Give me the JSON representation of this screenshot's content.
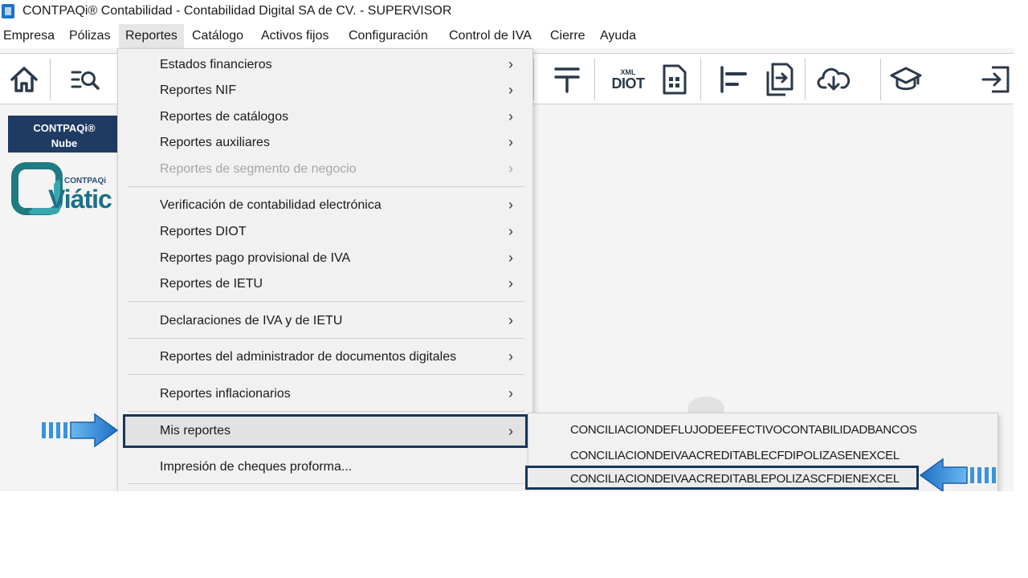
{
  "window": {
    "title": "CONTPAQi® Contabilidad - Contabilidad Digital SA de CV. - SUPERVISOR"
  },
  "menubar": {
    "items": [
      {
        "label": "Empresa"
      },
      {
        "label": "Pólizas"
      },
      {
        "label": "Reportes"
      },
      {
        "label": "Catálogo"
      },
      {
        "label": "Activos fijos"
      },
      {
        "label": "Configuración"
      },
      {
        "label": "Control de IVA"
      },
      {
        "label": "Cierre"
      },
      {
        "label": "Ayuda"
      }
    ],
    "active": "Reportes"
  },
  "toolbar": {
    "diot_small": "XML",
    "diot_big": "DIOT",
    "icons": [
      "home-icon",
      "search-list-icon",
      "tax-symbol-icon",
      "diot-icon",
      "calculator-doc-icon",
      "align-left-icon",
      "export-doc-icon",
      "cloud-download-icon",
      "graduation-cap-icon",
      "exit-icon"
    ]
  },
  "sidebar": {
    "nube_line1": "CONTPAQi®",
    "nube_line2": "Nube",
    "logo_small": "CONTPAQi",
    "logo_big": "Viátic"
  },
  "reportes_menu": {
    "arrow": "›",
    "items": [
      {
        "label": "Estados financieros"
      },
      {
        "label": "Reportes NIF"
      },
      {
        "label": "Reportes de catálogos"
      },
      {
        "label": "Reportes auxiliares"
      },
      {
        "label": "Reportes de segmento de negocio",
        "disabled": true
      },
      {
        "label": "Verificación de contabilidad electrónica"
      },
      {
        "label": "Reportes DIOT"
      },
      {
        "label": "Reportes pago provisional de IVA"
      },
      {
        "label": "Reportes de IETU"
      },
      {
        "label": "Declaraciones de IVA y de IETU"
      },
      {
        "label": "Reportes del administrador de documentos digitales"
      },
      {
        "label": "Reportes inflacionarios"
      },
      {
        "label": "Mis reportes",
        "highlighted": true
      },
      {
        "label": "Impresión de cheques proforma..."
      }
    ]
  },
  "mis_reportes_submenu": {
    "items": [
      {
        "label": "CONCILIACIONDEFLUJODEEFECTIVOCONTABILIDADBANCOS"
      },
      {
        "label": "CONCILIACIONDEIVAACREDITABLECFDIPOLIZASENEXCEL"
      },
      {
        "label": "CONCILIACIONDEIVAACREDITABLEPOLIZASCFDIENEXCEL",
        "highlighted": true
      }
    ]
  },
  "colors": {
    "highlight_border": "#16365c",
    "callout_arrow": "#1f6fc4",
    "nube_bg": "#1f3b63",
    "logo_teal": "#1e7b82"
  }
}
